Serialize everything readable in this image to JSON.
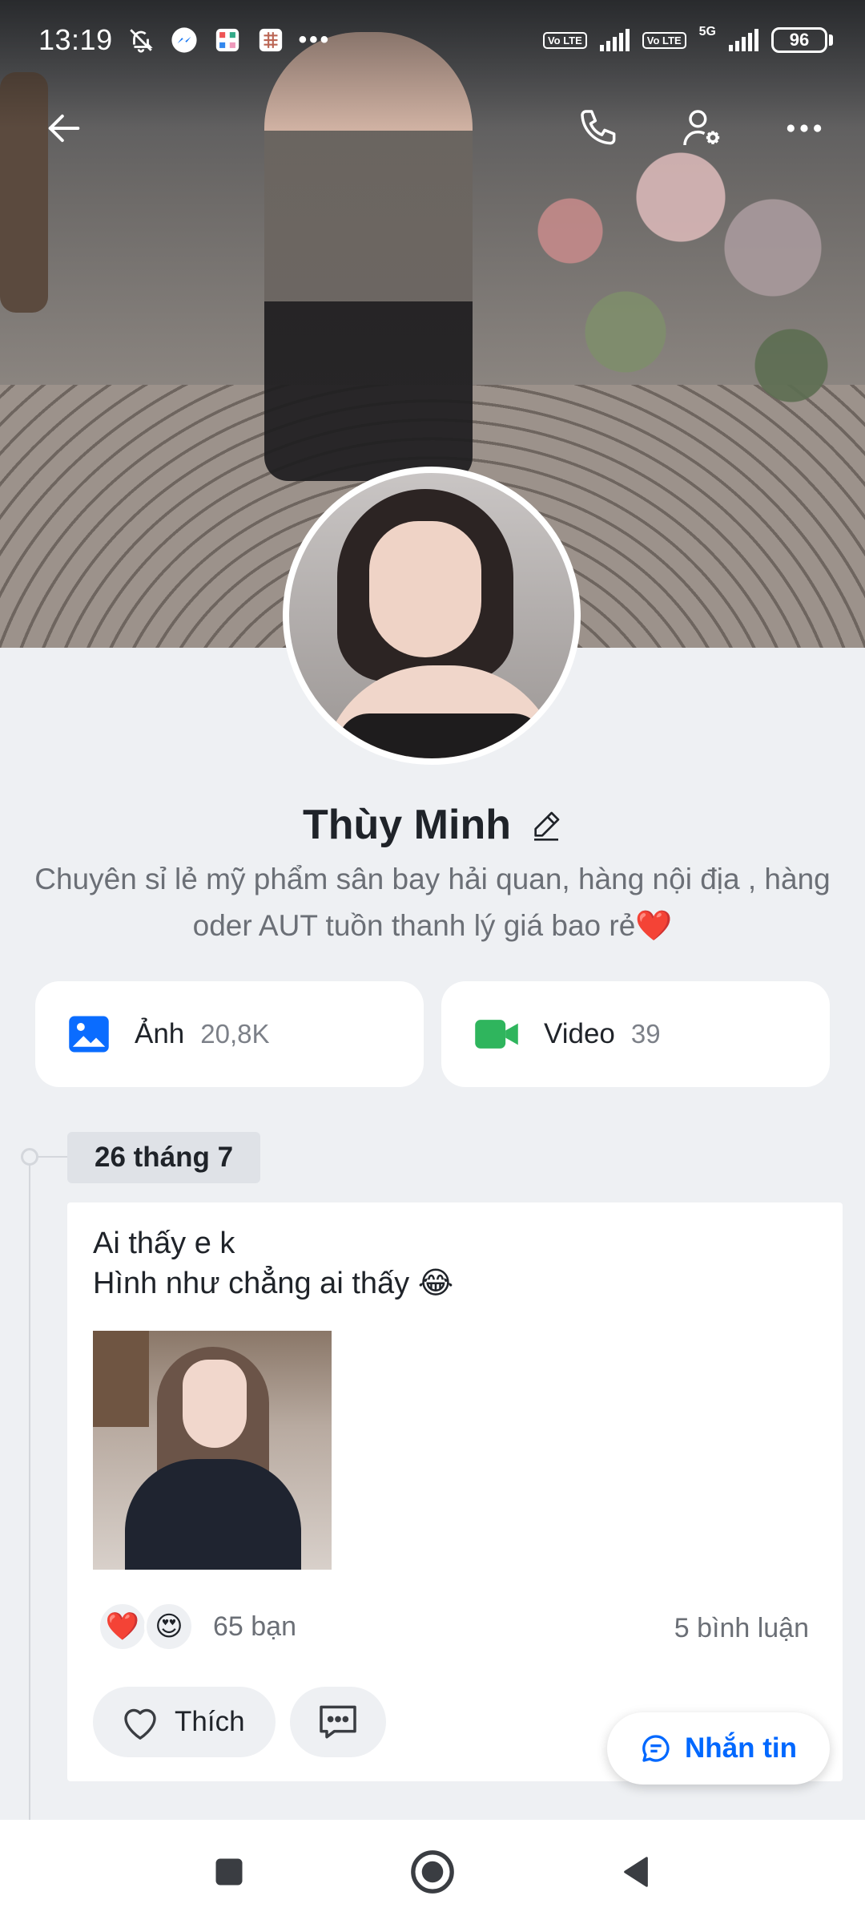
{
  "status_bar": {
    "time": "13:19",
    "network_badge": "Vo LTE",
    "net_type": "5G",
    "battery": "96",
    "more_dots": "•••"
  },
  "profile": {
    "name": "Thùy Minh",
    "bio": "Chuyên sỉ lẻ mỹ phẩm sân bay hải quan, hàng nội địa , hàng oder AUT tuồn thanh lý giá bao rẻ❤️"
  },
  "media": {
    "photos_label": "Ảnh",
    "photos_count": "20,8K",
    "videos_label": "Video",
    "videos_count": "39"
  },
  "timeline": {
    "date_label": "26 tháng 7"
  },
  "post": {
    "line1": "Ai thấy e k",
    "line2": "Hình như chẳng ai thấy 😂",
    "reaction_heart": "❤️",
    "reaction_love_eyes": "😍",
    "reactions_count": "65 bạn",
    "comments_count": "5 bình luận",
    "like_label": "Thích"
  },
  "fab": {
    "message_label": "Nhắn tin"
  },
  "colors": {
    "accent": "#0068ff",
    "photo_icon": "#0a6cff",
    "video_icon": "#2fb55d",
    "background": "#eef0f3"
  }
}
